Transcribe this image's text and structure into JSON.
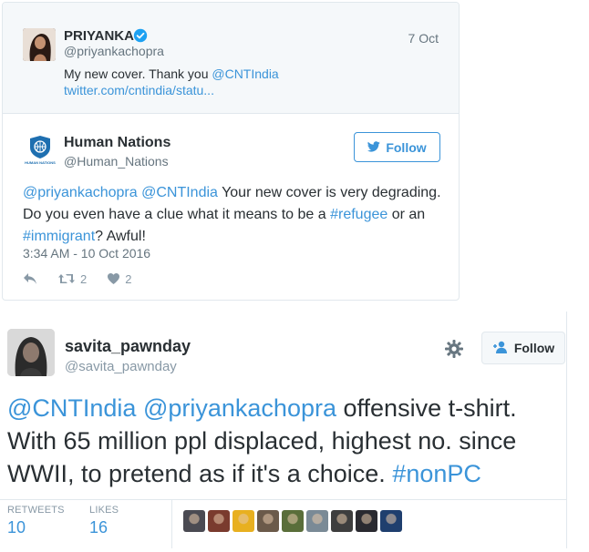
{
  "quoted_tweet": {
    "name": "PRIYANKA",
    "handle": "@priyankachopra",
    "date": "7 Oct",
    "text_prefix": "My new cover. Thank you ",
    "mention": "@CNTIndia",
    "link": "twitter.com/cntindia/statu..."
  },
  "reply_tweet": {
    "name": "Human Nations",
    "handle": "@Human_Nations",
    "logo_text": "HUMAN NATIONS",
    "follow_label": "Follow",
    "text": {
      "m1": "@priyankachopra",
      "m2": "@CNTIndia",
      "t1": " Your new cover is very degrading. Do you even have a clue what it means to be a ",
      "h1": "#refugee",
      "t2": " or an ",
      "h2": "#immigrant",
      "t3": "? Awful!"
    },
    "timestamp": "3:34 AM - 10 Oct 2016",
    "retweets": "2",
    "likes": "2"
  },
  "main_tweet": {
    "name": "savita_pawnday",
    "handle": "@savita_pawnday",
    "follow_label": "Follow",
    "text": {
      "m1": "@CNTIndia",
      "m2": "@priyankachopra",
      "t1": " offensive t-shirt. With 65 million ppl displaced, highest no. since WWII, to pretend as if it's a choice. ",
      "h1": "#nonPC"
    },
    "retweets_label": "RETWEETS",
    "retweets_count": "10",
    "likes_label": "LIKES",
    "likes_count": "16",
    "liker_colors": [
      "#4a4a52",
      "#7a3b2e",
      "#e8b020",
      "#6b5a4a",
      "#5a6e3a",
      "#7a8a96",
      "#3e3e3e",
      "#2a2a30",
      "#1f3f6e"
    ]
  },
  "colors": {
    "link_blue": "#3b94d9",
    "verified_blue": "#1da1f2",
    "text_dark": "#292f33",
    "text_gray": "#66757f",
    "border": "#e1e8ed"
  },
  "icons": [
    "verified-badge-icon",
    "twitter-bird-icon",
    "reply-icon",
    "retweet-icon",
    "heart-icon",
    "gear-icon",
    "add-user-icon"
  ]
}
